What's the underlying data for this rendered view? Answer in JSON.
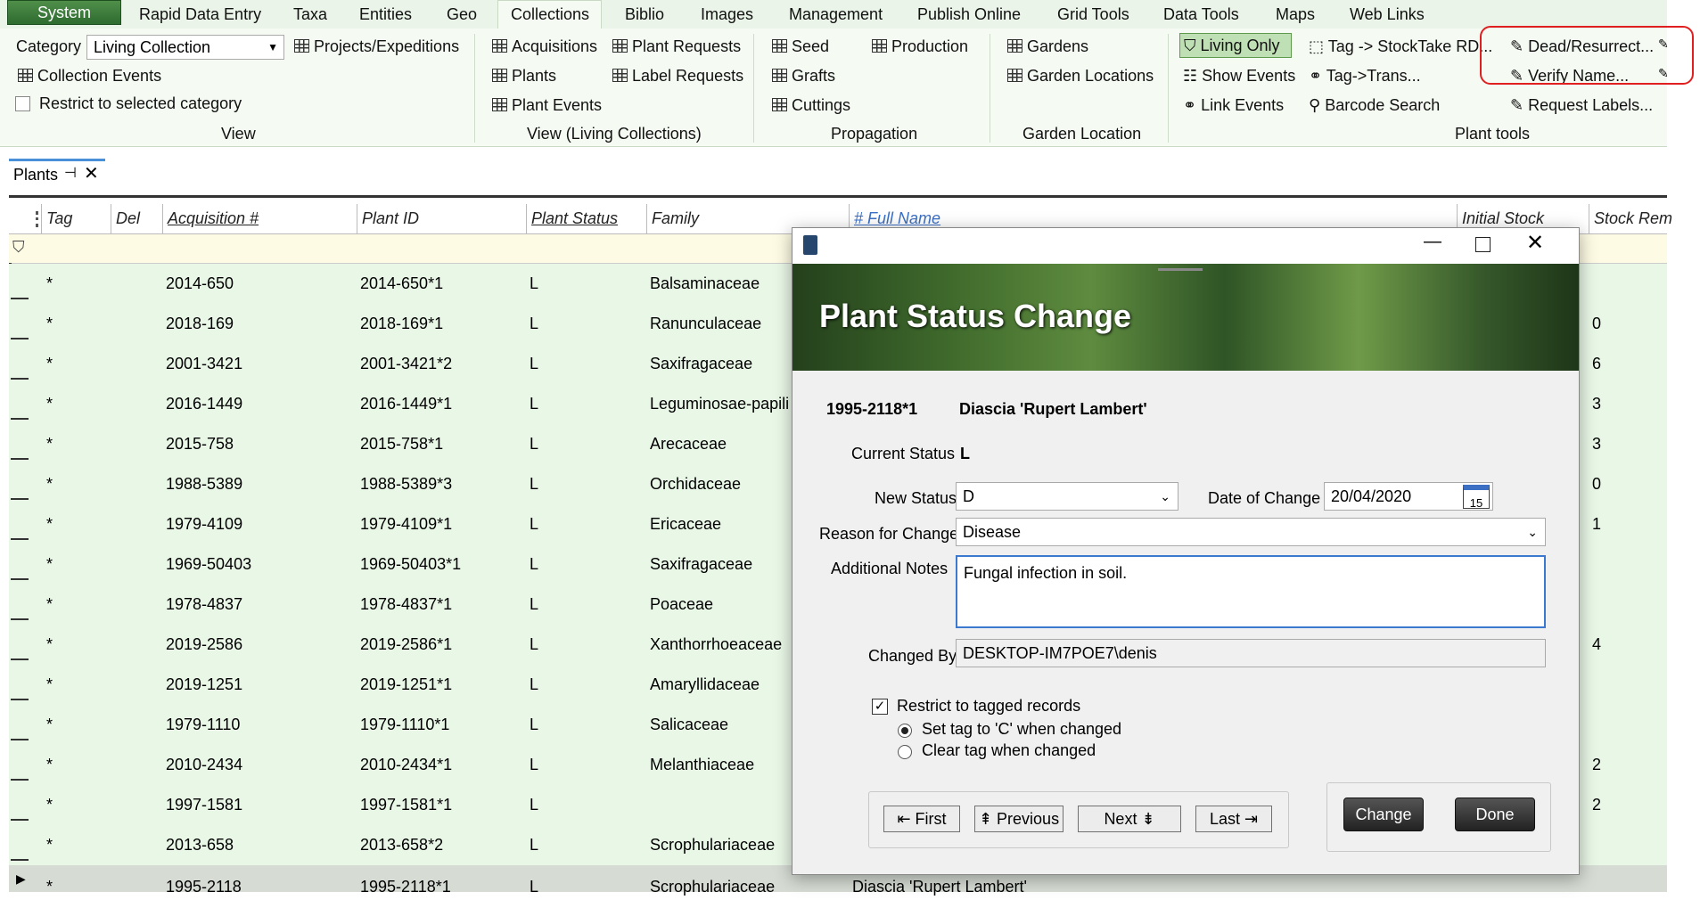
{
  "menubar": {
    "system": "System",
    "items": [
      "Rapid Data Entry",
      "Taxa",
      "Entities",
      "Geo",
      "Collections",
      "Biblio",
      "Images",
      "Management",
      "Publish Online",
      "Grid Tools",
      "Data Tools",
      "Maps",
      "Web Links"
    ]
  },
  "ribbon": {
    "category_label": "Category",
    "category_value": "Living Collection",
    "projects": "Projects/Expeditions",
    "collection_events": "Collection Events",
    "restrict_category": "Restrict to selected category",
    "view_group": "View",
    "acquisitions": "Acquisitions",
    "plant_requests": "Plant Requests",
    "plants": "Plants",
    "label_requests": "Label Requests",
    "plant_events": "Plant Events",
    "view_living_group": "View (Living Collections)",
    "seed": "Seed",
    "production": "Production",
    "grafts": "Grafts",
    "cuttings": "Cuttings",
    "propagation_group": "Propagation",
    "gardens": "Gardens",
    "garden_locations": "Garden Locations",
    "garden_location_group": "Garden Location",
    "living_only": "Living Only",
    "show_events": "Show Events",
    "link_events": "Link Events",
    "tag_stocktake": "Tag -> StockTake RD...",
    "tag_trans": "Tag->Trans...",
    "barcode_search": "Barcode Search",
    "dead_resurrect": "Dead/Resurrect...",
    "verify_name": "Verify Name...",
    "request_labels": "Request Labels...",
    "plant_tools_group": "Plant tools"
  },
  "plants_tab": {
    "label": "Plants"
  },
  "grid": {
    "columns": [
      "Tag",
      "Del",
      "Acquisition #",
      "Plant ID",
      "Plant Status",
      "Family",
      "# Full Name",
      "Initial Stock",
      "Stock Remo"
    ],
    "rows": [
      {
        "tag": "*",
        "acq": "2014-650",
        "pid": "2014-650*1",
        "status": "L",
        "family": "Balsaminaceae",
        "name": "",
        "stock": ""
      },
      {
        "tag": "*",
        "acq": "2018-169",
        "pid": "2018-169*1",
        "status": "L",
        "family": "Ranunculaceae",
        "name": "",
        "stock": "0"
      },
      {
        "tag": "*",
        "acq": "2001-3421",
        "pid": "2001-3421*2",
        "status": "L",
        "family": "Saxifragaceae",
        "name": "",
        "stock": "6"
      },
      {
        "tag": "*",
        "acq": "2016-1449",
        "pid": "2016-1449*1",
        "status": "L",
        "family": "Leguminosae-papili",
        "name": "",
        "stock": "3"
      },
      {
        "tag": "*",
        "acq": "2015-758",
        "pid": "2015-758*1",
        "status": "L",
        "family": "Arecaceae",
        "name": "",
        "stock": "3"
      },
      {
        "tag": "*",
        "acq": "1988-5389",
        "pid": "1988-5389*3",
        "status": "L",
        "family": "Orchidaceae",
        "name": "",
        "stock": "0"
      },
      {
        "tag": "*",
        "acq": "1979-4109",
        "pid": "1979-4109*1",
        "status": "L",
        "family": "Ericaceae",
        "name": "",
        "stock": "1"
      },
      {
        "tag": "*",
        "acq": "1969-50403",
        "pid": "1969-50403*1",
        "status": "L",
        "family": "Saxifragaceae",
        "name": "",
        "stock": ""
      },
      {
        "tag": "*",
        "acq": "1978-4837",
        "pid": "1978-4837*1",
        "status": "L",
        "family": "Poaceae",
        "name": "",
        "stock": ""
      },
      {
        "tag": "*",
        "acq": "2019-2586",
        "pid": "2019-2586*1",
        "status": "L",
        "family": "Xanthorrhoeaceae",
        "name": "",
        "stock": "4"
      },
      {
        "tag": "*",
        "acq": "2019-1251",
        "pid": "2019-1251*1",
        "status": "L",
        "family": "Amaryllidaceae",
        "name": "",
        "stock": ""
      },
      {
        "tag": "*",
        "acq": "1979-1110",
        "pid": "1979-1110*1",
        "status": "L",
        "family": "Salicaceae",
        "name": "",
        "stock": ""
      },
      {
        "tag": "*",
        "acq": "2010-2434",
        "pid": "2010-2434*1",
        "status": "L",
        "family": "Melanthiaceae",
        "name": "",
        "stock": "2"
      },
      {
        "tag": "*",
        "acq": "1997-1581",
        "pid": "1997-1581*1",
        "status": "L",
        "family": "",
        "name": "",
        "stock": "2"
      },
      {
        "tag": "*",
        "acq": "2013-658",
        "pid": "2013-658*2",
        "status": "L",
        "family": "Scrophulariaceae",
        "name": "",
        "stock": ""
      },
      {
        "tag": "*",
        "acq": "1995-2118",
        "pid": "1995-2118*1",
        "status": "L",
        "family": "Scrophulariaceae",
        "name": "Diascia 'Rupert Lambert'",
        "stock": ""
      }
    ]
  },
  "dialog": {
    "banner_title": "Plant Status Change",
    "plant_id": "1995-2118*1",
    "plant_name": "Diascia 'Rupert Lambert'",
    "current_status_label": "Current Status",
    "current_status_value": "L",
    "new_status_label": "New Status",
    "new_status_value": "D",
    "date_label": "Date of Change",
    "date_value": "20/04/2020",
    "calendar_day": "15",
    "reason_label": "Reason for Change",
    "reason_value": "Disease",
    "notes_label": "Additional Notes",
    "notes_value": "Fungal infection in soil.",
    "changed_by_label": "Changed By",
    "changed_by_value": "DESKTOP-IM7POE7\\denis",
    "restrict_tagged": "Restrict to tagged records",
    "set_tag": "Set tag to 'C' when changed",
    "clear_tag": "Clear tag when changed",
    "first": "First",
    "previous": "Previous",
    "next": "Next",
    "last": "Last",
    "change": "Change",
    "done": "Done"
  }
}
